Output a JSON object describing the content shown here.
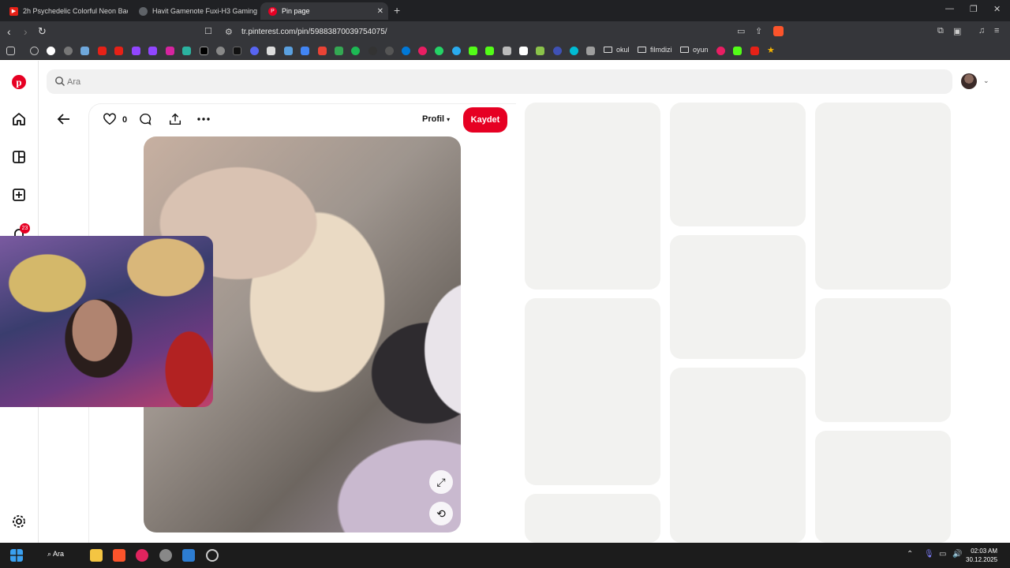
{
  "tabs": [
    {
      "title": "2h Psychedelic Colorful Neon Backgr",
      "active": false
    },
    {
      "title": "Havit Gamenote Fuxi-H3 Gaming Oy",
      "active": false
    },
    {
      "title": "Pin page",
      "active": true
    }
  ],
  "address": {
    "url": "tr.pinterest.com/pin/59883870039754075/"
  },
  "bookmarks": {
    "folders": [
      "okul",
      "filmdizi",
      "oyun"
    ]
  },
  "search": {
    "placeholder": "Ara"
  },
  "notifications": {
    "count": "23"
  },
  "pin": {
    "like_count": "0",
    "profile_label": "Profil",
    "save_label": "Kaydet"
  },
  "taskbar": {
    "search_label": "Ara",
    "time": "02:03 AM",
    "date": "30.12.2025"
  },
  "colors": {
    "brand": "#e60023",
    "chrome_dark": "#202124",
    "skeleton": "#f2f2f0"
  }
}
